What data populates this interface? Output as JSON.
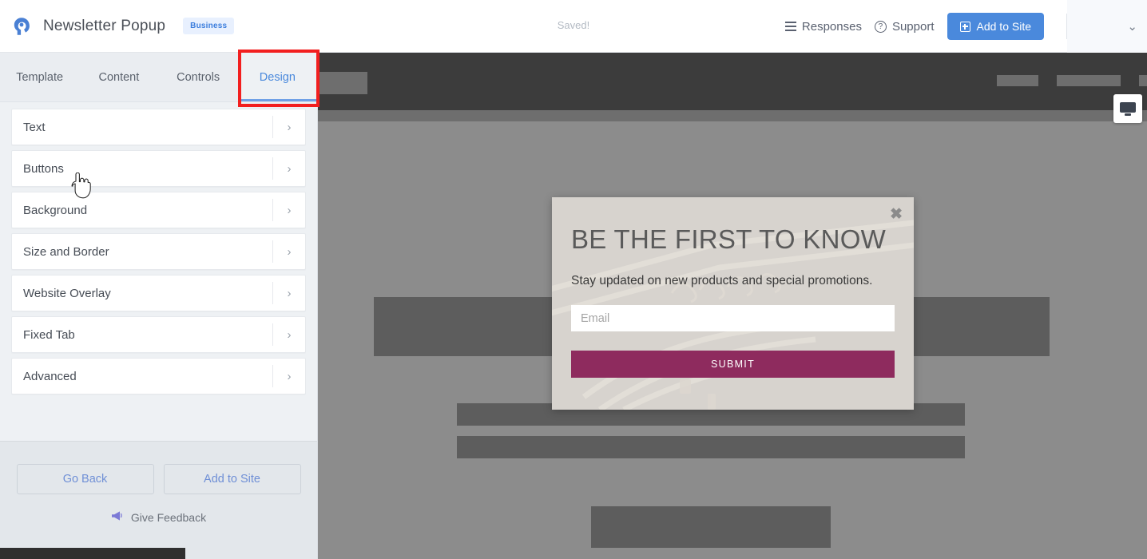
{
  "header": {
    "logo_icon": "powr-logo-icon",
    "title": "Newsletter Popup",
    "badge": "Business",
    "status": "Saved!",
    "responses_label": "Responses",
    "responses_icon": "list-icon",
    "support_label": "Support",
    "support_icon": "help-circle-icon",
    "add_to_site_label": "Add to Site",
    "add_to_site_icon": "plus-square-icon",
    "account_chevron_icon": "chevron-down-icon",
    "accent_blue": "#4a89dc"
  },
  "tabs": [
    {
      "label": "Template",
      "active": false
    },
    {
      "label": "Content",
      "active": false
    },
    {
      "label": "Controls",
      "active": false
    },
    {
      "label": "Design",
      "active": true
    }
  ],
  "design_options": [
    {
      "label": "Text"
    },
    {
      "label": "Buttons"
    },
    {
      "label": "Background"
    },
    {
      "label": "Size and Border"
    },
    {
      "label": "Website Overlay"
    },
    {
      "label": "Fixed Tab"
    },
    {
      "label": "Advanced"
    }
  ],
  "panel_footer": {
    "go_back_label": "Go Back",
    "add_to_site_label": "Add to Site",
    "feedback_label": "Give Feedback",
    "feedback_icon": "megaphone-icon"
  },
  "preview": {
    "device_toggle_icon": "desktop-monitor-icon"
  },
  "popup": {
    "title": "BE THE FIRST TO KNOW",
    "subtitle": "Stay updated on new products and special promotions.",
    "email_placeholder": "Email",
    "email_value": "",
    "submit_label": "SUBMIT",
    "close_icon": "close-x-icon",
    "submit_color": "#8e2b5e",
    "background_color": "#d6d3ce"
  },
  "annotation": {
    "highlight_target": "Design",
    "highlight_color": "#f21f1f"
  },
  "cursor": {
    "type": "pointer-hand",
    "over": "Buttons"
  }
}
